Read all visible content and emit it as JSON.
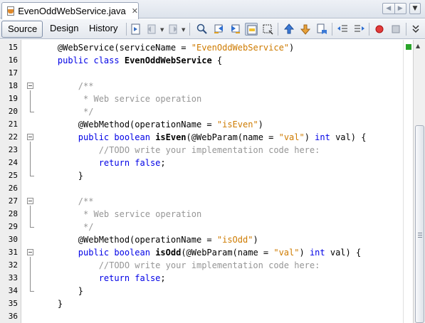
{
  "tab": {
    "filename": "EvenOddWebService.java",
    "close_glyph": "✕",
    "icon": "java-file-icon"
  },
  "tab_controls": {
    "prev_glyph": "◀",
    "next_glyph": "▶",
    "dropdown_glyph": "▼"
  },
  "toolbar": {
    "views": [
      "Source",
      "Design",
      "History"
    ],
    "active_view": "Source",
    "icons": [
      "last-edit-icon",
      "back-icon",
      "forward-icon",
      "find-selection-icon",
      "find-previous-icon",
      "find-next-icon",
      "toggle-highlight-search-icon",
      "toggle-rectangular-selection-icon",
      "previous-bookmark-icon",
      "next-bookmark-icon",
      "toggle-bookmark-icon",
      "shift-left-icon",
      "shift-right-icon",
      "start-macro-recording-icon",
      "stop-macro-recording-icon",
      "more-toolbar-icon"
    ]
  },
  "editor": {
    "lines": [
      {
        "num": "15",
        "tokens": [
          {
            "t": "    @WebService(serviceName = ",
            "c": ""
          },
          {
            "t": "\"EvenOddWebService\"",
            "c": "s"
          },
          {
            "t": ")",
            "c": ""
          }
        ]
      },
      {
        "num": "16",
        "tokens": [
          {
            "t": "    ",
            "c": ""
          },
          {
            "t": "public class",
            "c": "k"
          },
          {
            "t": " ",
            "c": ""
          },
          {
            "t": "EvenOddWebService",
            "c": "b"
          },
          {
            "t": " {",
            "c": ""
          }
        ]
      },
      {
        "num": "17",
        "tokens": []
      },
      {
        "num": "18",
        "tokens": [
          {
            "t": "        /**",
            "c": "c"
          }
        ]
      },
      {
        "num": "19",
        "tokens": [
          {
            "t": "         * Web service operation",
            "c": "c"
          }
        ]
      },
      {
        "num": "20",
        "tokens": [
          {
            "t": "         */",
            "c": "c"
          }
        ]
      },
      {
        "num": "21",
        "tokens": [
          {
            "t": "        @WebMethod(operationName = ",
            "c": ""
          },
          {
            "t": "\"isEven\"",
            "c": "s"
          },
          {
            "t": ")",
            "c": ""
          }
        ]
      },
      {
        "num": "22",
        "tokens": [
          {
            "t": "        ",
            "c": ""
          },
          {
            "t": "public boolean",
            "c": "k"
          },
          {
            "t": " ",
            "c": ""
          },
          {
            "t": "isEven",
            "c": "b"
          },
          {
            "t": "(@WebParam(name = ",
            "c": ""
          },
          {
            "t": "\"val\"",
            "c": "s"
          },
          {
            "t": ") ",
            "c": ""
          },
          {
            "t": "int",
            "c": "k"
          },
          {
            "t": " val) {",
            "c": ""
          }
        ]
      },
      {
        "num": "23",
        "tokens": [
          {
            "t": "            //TODO write your implementation code here:",
            "c": "c"
          }
        ]
      },
      {
        "num": "24",
        "tokens": [
          {
            "t": "            ",
            "c": ""
          },
          {
            "t": "return false",
            "c": "k"
          },
          {
            "t": ";",
            "c": ""
          }
        ]
      },
      {
        "num": "25",
        "tokens": [
          {
            "t": "        }",
            "c": ""
          }
        ]
      },
      {
        "num": "26",
        "tokens": []
      },
      {
        "num": "27",
        "tokens": [
          {
            "t": "        /**",
            "c": "c"
          }
        ]
      },
      {
        "num": "28",
        "tokens": [
          {
            "t": "         * Web service operation",
            "c": "c"
          }
        ]
      },
      {
        "num": "29",
        "tokens": [
          {
            "t": "         */",
            "c": "c"
          }
        ]
      },
      {
        "num": "30",
        "tokens": [
          {
            "t": "        @WebMethod(operationName = ",
            "c": ""
          },
          {
            "t": "\"isOdd\"",
            "c": "s"
          },
          {
            "t": ")",
            "c": ""
          }
        ]
      },
      {
        "num": "31",
        "tokens": [
          {
            "t": "        ",
            "c": ""
          },
          {
            "t": "public boolean",
            "c": "k"
          },
          {
            "t": " ",
            "c": ""
          },
          {
            "t": "isOdd",
            "c": "b"
          },
          {
            "t": "(@WebParam(name = ",
            "c": ""
          },
          {
            "t": "\"val\"",
            "c": "s"
          },
          {
            "t": ") ",
            "c": ""
          },
          {
            "t": "int",
            "c": "k"
          },
          {
            "t": " val) {",
            "c": ""
          }
        ]
      },
      {
        "num": "32",
        "tokens": [
          {
            "t": "            //TODO write your implementation code here:",
            "c": "c"
          }
        ]
      },
      {
        "num": "33",
        "tokens": [
          {
            "t": "            ",
            "c": ""
          },
          {
            "t": "return false",
            "c": "k"
          },
          {
            "t": ";",
            "c": ""
          }
        ]
      },
      {
        "num": "34",
        "tokens": [
          {
            "t": "        }",
            "c": ""
          }
        ]
      },
      {
        "num": "35",
        "tokens": [
          {
            "t": "    }",
            "c": ""
          }
        ]
      },
      {
        "num": "36",
        "tokens": []
      }
    ],
    "folds": [
      {
        "start": "18",
        "end": "20"
      },
      {
        "start": "22",
        "end": "25"
      },
      {
        "start": "27",
        "end": "29"
      },
      {
        "start": "31",
        "end": "34"
      }
    ]
  },
  "colors": {
    "keyword": "#0000e6",
    "string": "#ce7b00",
    "comment": "#969696",
    "ok_marker": "#2aa52a"
  }
}
